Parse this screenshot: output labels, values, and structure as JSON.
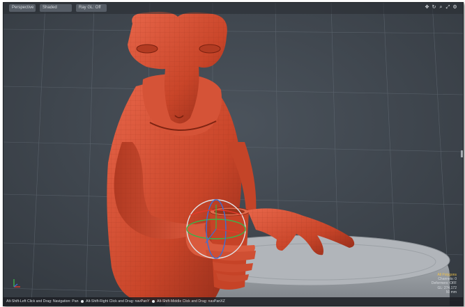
{
  "viewport": {
    "tabs": [
      {
        "label": "Perspective"
      },
      {
        "label": "Shaded"
      },
      {
        "label": "Ray GL: Off"
      }
    ],
    "icons": [
      "move-view-icon",
      "rotate-view-icon",
      "zoom-view-icon",
      "maximize-icon",
      "settings-icon"
    ]
  },
  "status_bar": {
    "hints": [
      "Alt-Shift-Left Click and Drag: Navigation: Pan",
      "Alt-Shift-Right Click and Drag: navPanY",
      "Alt-Shift-Middle Click and Drag: navPanXZ"
    ]
  },
  "info_overlay": {
    "selection": "All Polygons",
    "channels": "Channels: 0",
    "deformers": "Deformers: OFF",
    "gl": "GL: 274,172",
    "lens": "50 mm"
  },
  "colors": {
    "viewport_bg": "#3f464e",
    "model": "#cc4a30",
    "highlight": "#f0c24a"
  }
}
